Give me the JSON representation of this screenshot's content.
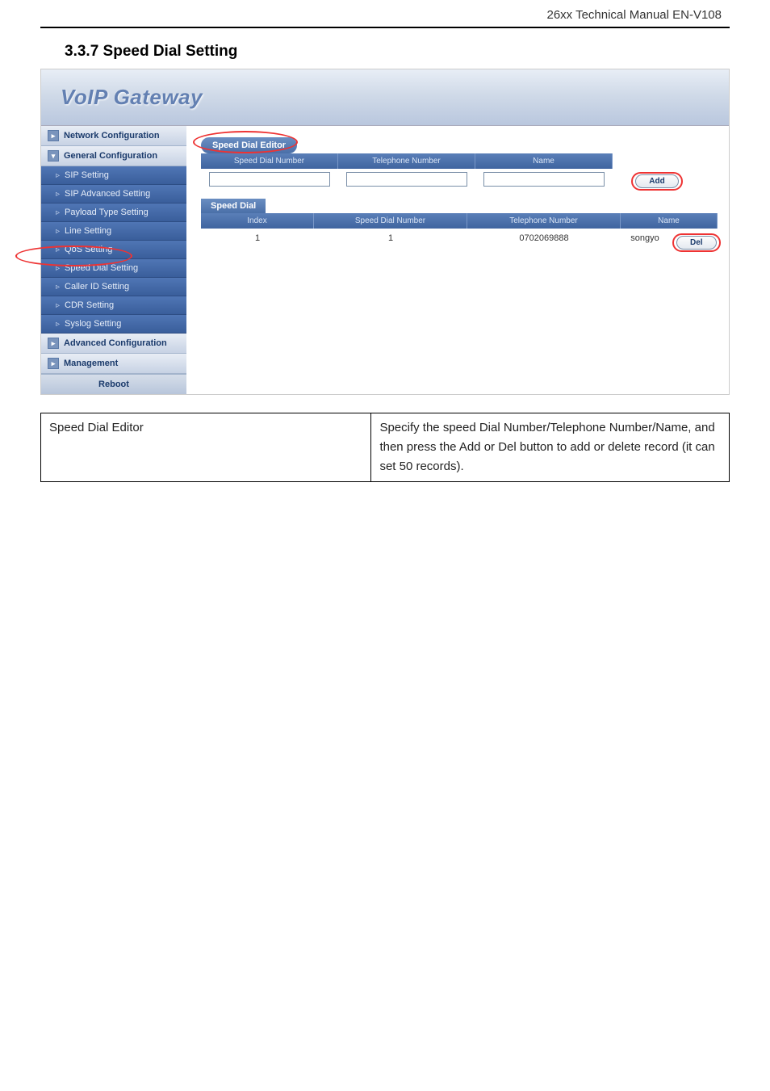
{
  "doc_header": "26xx Technical Manual EN-V108",
  "section_title": "3.3.7 Speed Dial Setting",
  "banner_title": "VoIP  Gateway",
  "sidebar": {
    "groups": [
      {
        "label": "Network Configuration",
        "expandable": true
      },
      {
        "label": "General Configuration",
        "expandable": true
      }
    ],
    "sub_items": [
      "SIP Setting",
      "SIP Advanced Setting",
      "Payload Type Setting",
      "Line Setting",
      "QoS Setting",
      "Speed Dial Setting",
      "Caller ID Setting",
      "CDR Setting",
      "Syslog Setting"
    ],
    "bottom_groups": [
      {
        "label": "Advanced Configuration"
      },
      {
        "label": "Management"
      }
    ],
    "reboot_label": "Reboot"
  },
  "editor": {
    "tab_label": "Speed Dial Editor",
    "headers": [
      "Speed Dial Number",
      "Telephone Number",
      "Name"
    ],
    "add_button": "Add"
  },
  "speed_dial": {
    "tab_label": "Speed Dial",
    "headers": [
      "Index",
      "Speed Dial Number",
      "Telephone Number",
      "Name"
    ],
    "rows": [
      {
        "index": "1",
        "speed_dial": "1",
        "telephone": "0702069888",
        "name": "songyo"
      }
    ],
    "del_button": "Del"
  },
  "description_table": {
    "left": "Speed Dial Editor",
    "right": "Specify the speed Dial Number/Telephone Number/Name, and then press the Add or Del button to add or delete record (it can set 50 records)."
  }
}
